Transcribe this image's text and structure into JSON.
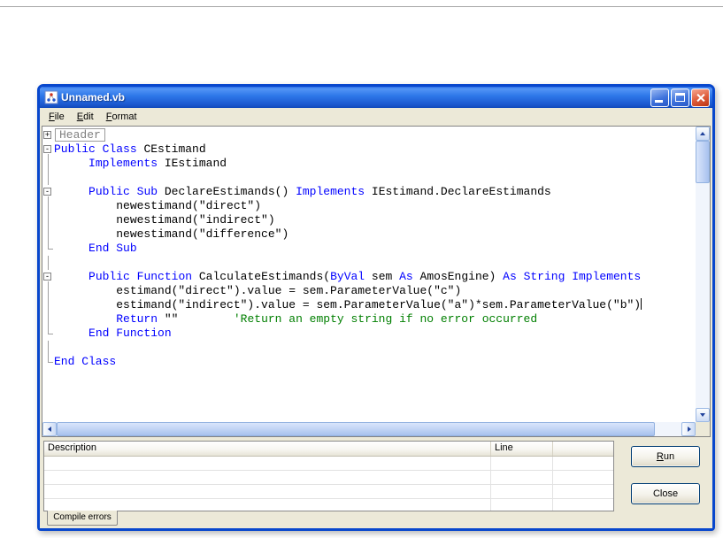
{
  "window": {
    "title": "Unnamed.vb"
  },
  "menu": {
    "items": [
      {
        "label": "File"
      },
      {
        "label": "Edit"
      },
      {
        "label": "Format"
      }
    ]
  },
  "editor": {
    "colors": {
      "keyword": "#0000FF",
      "plain": "#000000",
      "comment": "#007F00",
      "header": "#808080"
    },
    "fold_icons": {
      "plus": "+",
      "minus": "-"
    },
    "lines": [
      {
        "gutter": "plus",
        "segments": [
          {
            "type": "header",
            "text": "Header"
          }
        ]
      },
      {
        "gutter": "minus",
        "segments": [
          {
            "type": "keyword",
            "text": "Public"
          },
          {
            "type": "plain",
            "text": " "
          },
          {
            "type": "keyword",
            "text": "Class"
          },
          {
            "type": "plain",
            "text": " CEstimand"
          }
        ]
      },
      {
        "gutter": "line",
        "segments": [
          {
            "type": "plain",
            "text": "     "
          },
          {
            "type": "keyword",
            "text": "Implements"
          },
          {
            "type": "plain",
            "text": " IEstimand"
          }
        ]
      },
      {
        "gutter": "line",
        "segments": []
      },
      {
        "gutter": "minus",
        "segments": [
          {
            "type": "plain",
            "text": "     "
          },
          {
            "type": "keyword",
            "text": "Public"
          },
          {
            "type": "plain",
            "text": " "
          },
          {
            "type": "keyword",
            "text": "Sub"
          },
          {
            "type": "plain",
            "text": " DeclareEstimands() "
          },
          {
            "type": "keyword",
            "text": "Implements"
          },
          {
            "type": "plain",
            "text": " IEstimand.DeclareEstimands"
          }
        ]
      },
      {
        "gutter": "line",
        "segments": [
          {
            "type": "plain",
            "text": "         newestimand(\"direct\")"
          }
        ]
      },
      {
        "gutter": "line",
        "segments": [
          {
            "type": "plain",
            "text": "         newestimand(\"indirect\")"
          }
        ]
      },
      {
        "gutter": "line",
        "segments": [
          {
            "type": "plain",
            "text": "         newestimand(\"difference\")"
          }
        ]
      },
      {
        "gutter": "end",
        "segments": [
          {
            "type": "plain",
            "text": "     "
          },
          {
            "type": "keyword",
            "text": "End Sub"
          }
        ]
      },
      {
        "gutter": "line",
        "segments": []
      },
      {
        "gutter": "minus",
        "segments": [
          {
            "type": "plain",
            "text": "     "
          },
          {
            "type": "keyword",
            "text": "Public"
          },
          {
            "type": "plain",
            "text": " "
          },
          {
            "type": "keyword",
            "text": "Function"
          },
          {
            "type": "plain",
            "text": " CalculateEstimands("
          },
          {
            "type": "keyword",
            "text": "ByVal"
          },
          {
            "type": "plain",
            "text": " sem "
          },
          {
            "type": "keyword",
            "text": "As"
          },
          {
            "type": "plain",
            "text": " AmosEngine) "
          },
          {
            "type": "keyword",
            "text": "As"
          },
          {
            "type": "plain",
            "text": " "
          },
          {
            "type": "keyword",
            "text": "String"
          },
          {
            "type": "plain",
            "text": " "
          },
          {
            "type": "keyword",
            "text": "Implements"
          }
        ]
      },
      {
        "gutter": "line",
        "segments": [
          {
            "type": "plain",
            "text": "         estimand(\"direct\").value = sem.ParameterValue(\"c\")"
          }
        ]
      },
      {
        "gutter": "line",
        "caret": true,
        "segments": [
          {
            "type": "plain",
            "text": "         estimand(\"indirect\").value = sem.ParameterValue(\"a\")*sem.ParameterValue(\"b\")"
          }
        ]
      },
      {
        "gutter": "line",
        "segments": [
          {
            "type": "plain",
            "text": "         "
          },
          {
            "type": "keyword",
            "text": "Return"
          },
          {
            "type": "plain",
            "text": " \"\"        "
          },
          {
            "type": "comment",
            "text": "'Return an empty string if no error occurred"
          }
        ]
      },
      {
        "gutter": "end",
        "segments": [
          {
            "type": "plain",
            "text": "     "
          },
          {
            "type": "keyword",
            "text": "End Function"
          }
        ]
      },
      {
        "gutter": "line",
        "segments": []
      },
      {
        "gutter": "end",
        "segments": [
          {
            "type": "keyword",
            "text": "End Class"
          }
        ]
      }
    ]
  },
  "error_panel": {
    "columns": [
      {
        "label": "Description"
      },
      {
        "label": "Line"
      },
      {
        "label": ""
      }
    ],
    "empty_row_count": 4,
    "tab_label": "Compile errors"
  },
  "buttons": {
    "run": {
      "label": "Run"
    },
    "close": {
      "label": "Close"
    }
  }
}
